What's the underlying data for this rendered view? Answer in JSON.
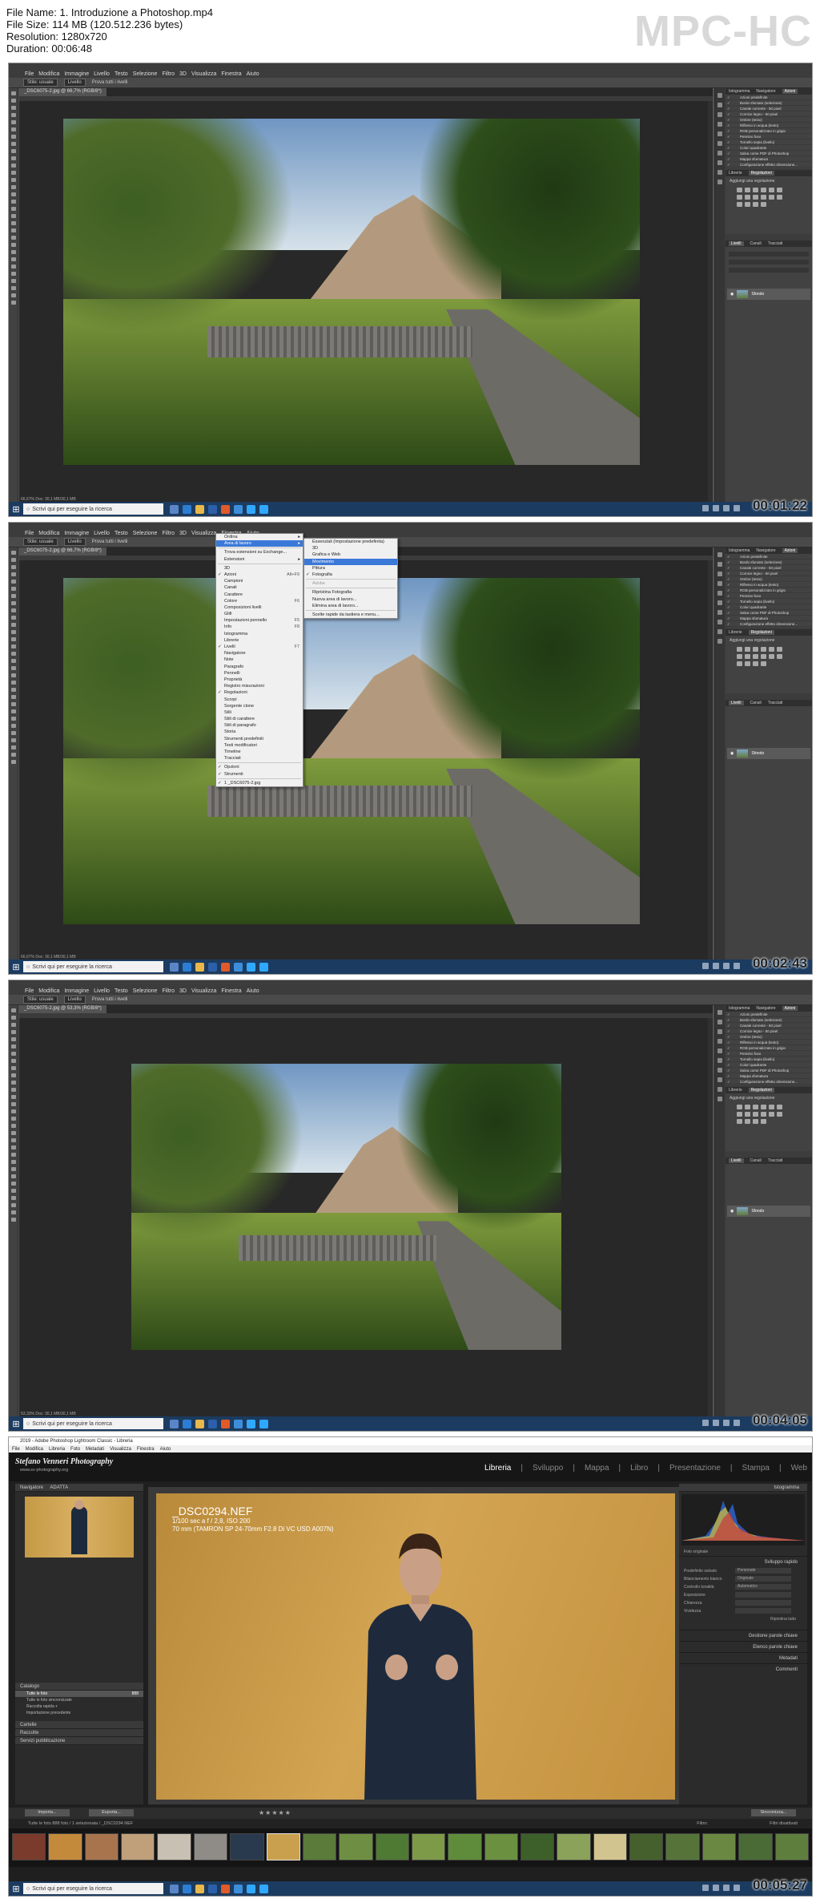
{
  "file_info": {
    "name": "File Name: 1. Introduzione a Photoshop.mp4",
    "size": "File Size: 114 MB (120.512.236 bytes)",
    "resolution": "Resolution: 1280x720",
    "duration": "Duration: 00:06:48"
  },
  "logo": "MPC-HC",
  "photoshop": {
    "menu": [
      "File",
      "Modifica",
      "Immagine",
      "Livello",
      "Testo",
      "Selezione",
      "Filtro",
      "3D",
      "Visualizza",
      "Finestra",
      "Aiuto"
    ],
    "options": {
      "style": "Stile: usuale",
      "level": "Livello",
      "sample": "Prova tutti i livelli"
    },
    "doc_tab_1": "_DSC6075-2.jpg @ 66,7% (RGB/8*)",
    "doc_tab_3": "_DSC6075-2.jpg @ 53,3% (RGB/8*)",
    "status_1": "66,67%   Doc: 30,1 MB/30,1 MB",
    "status_3": "53,33%   Doc: 30,1 MB/30,1 MB",
    "panel_tabs_top": [
      "Istogramma",
      "Navigatore",
      "Azioni"
    ],
    "actions": [
      "Azioni predefinite",
      "Bordo sfumato (selezione)",
      "Canale corrente - 50 pixel",
      "Cornice legno - 50 pixel",
      "Ombre (testo)",
      "Riflesso in acqua (testo)",
      "RGB personalizzato in grigio",
      "Pennino fuso",
      "Tornello sepia (livello)",
      "Colori quadrante",
      "Salva come PDF di Photoshop",
      "Mappa sfumatura",
      "Configurazione effetto dimensione..."
    ],
    "panel_tabs_mid": [
      "Librerie",
      "Regolazioni"
    ],
    "adj_label": "Aggiungi una regolazione",
    "panel_tabs_bottom": [
      "Livelli",
      "Canali",
      "Tracciati"
    ],
    "layer_name": "Sfondo",
    "search_placeholder": "Scrivi qui per eseguire la ricerca"
  },
  "window_menu": {
    "items": [
      {
        "label": "Ordina",
        "check": false,
        "shortcut": "",
        "arrow": true
      },
      {
        "label": "Area di lavoro",
        "check": false,
        "shortcut": "",
        "arrow": true,
        "selected": true
      },
      {
        "label": "",
        "sep": true
      },
      {
        "label": "Trova estensioni su Exchange...",
        "check": false,
        "shortcut": ""
      },
      {
        "label": "Estensioni",
        "check": false,
        "shortcut": "",
        "arrow": true
      },
      {
        "label": "",
        "sep": true
      },
      {
        "label": "3D",
        "check": false,
        "shortcut": ""
      },
      {
        "label": "Azioni",
        "check": true,
        "shortcut": "Alt+F9"
      },
      {
        "label": "Campioni",
        "check": false,
        "shortcut": ""
      },
      {
        "label": "Canali",
        "check": false,
        "shortcut": ""
      },
      {
        "label": "Carattere",
        "check": false,
        "shortcut": ""
      },
      {
        "label": "Colore",
        "check": false,
        "shortcut": "F6"
      },
      {
        "label": "Composizioni livelli",
        "check": false,
        "shortcut": ""
      },
      {
        "label": "Glifi",
        "check": false,
        "shortcut": ""
      },
      {
        "label": "Impostazioni pennello",
        "check": false,
        "shortcut": "F5"
      },
      {
        "label": "Info",
        "check": false,
        "shortcut": "F8"
      },
      {
        "label": "Istogramma",
        "check": false,
        "shortcut": ""
      },
      {
        "label": "Librerie",
        "check": false,
        "shortcut": ""
      },
      {
        "label": "Livelli",
        "check": true,
        "shortcut": "F7"
      },
      {
        "label": "Navigatore",
        "check": false,
        "shortcut": ""
      },
      {
        "label": "Note",
        "check": false,
        "shortcut": ""
      },
      {
        "label": "Paragrafo",
        "check": false,
        "shortcut": ""
      },
      {
        "label": "Pennelli",
        "check": false,
        "shortcut": ""
      },
      {
        "label": "Proprietà",
        "check": false,
        "shortcut": ""
      },
      {
        "label": "Registro misurazioni",
        "check": false,
        "shortcut": ""
      },
      {
        "label": "Regolazioni",
        "check": true,
        "shortcut": ""
      },
      {
        "label": "Scorpi",
        "check": false,
        "shortcut": ""
      },
      {
        "label": "Sorgente clone",
        "check": false,
        "shortcut": ""
      },
      {
        "label": "Stili",
        "check": false,
        "shortcut": ""
      },
      {
        "label": "Stili di carattere",
        "check": false,
        "shortcut": ""
      },
      {
        "label": "Stili di paragrafo",
        "check": false,
        "shortcut": ""
      },
      {
        "label": "Storia",
        "check": false,
        "shortcut": ""
      },
      {
        "label": "Strumenti predefiniti",
        "check": false,
        "shortcut": ""
      },
      {
        "label": "Testi modificatori",
        "check": false,
        "shortcut": ""
      },
      {
        "label": "Timeline",
        "check": false,
        "shortcut": ""
      },
      {
        "label": "Tracciati",
        "check": false,
        "shortcut": ""
      },
      {
        "label": "",
        "sep": true
      },
      {
        "label": "Opzioni",
        "check": true,
        "shortcut": ""
      },
      {
        "label": "Strumenti",
        "check": true,
        "shortcut": ""
      },
      {
        "label": "",
        "sep": true
      },
      {
        "label": "1 _DSC6075-2.jpg",
        "check": true,
        "shortcut": ""
      }
    ],
    "submenu": [
      {
        "label": "Essenziali (Impostazione predefinita)",
        "check": false
      },
      {
        "label": "3D",
        "check": false
      },
      {
        "label": "Grafica e Web",
        "check": false
      },
      {
        "label": "Movimento",
        "check": false,
        "selected": true
      },
      {
        "label": "Pittura",
        "check": false
      },
      {
        "label": "Fotografia",
        "check": true
      },
      {
        "label": "",
        "sep": true
      },
      {
        "label": "Adobe",
        "check": false,
        "dim": true
      },
      {
        "label": "",
        "sep": true
      },
      {
        "label": "Ripristina Fotografia",
        "check": false
      },
      {
        "label": "Nuova area di lavoro...",
        "check": false
      },
      {
        "label": "Elimina area di lavoro...",
        "check": false
      },
      {
        "label": "",
        "sep": true
      },
      {
        "label": "Scelte rapide da tastiera e menu...",
        "check": false
      }
    ]
  },
  "timestamps": [
    "00:01:22",
    "00:02:43",
    "00:04:05",
    "00:05:27"
  ],
  "lightroom": {
    "title": "2019 - Adobe Photoshop Lightroom Classic - Libreria",
    "menu": [
      "File",
      "Modifica",
      "Libreria",
      "Foto",
      "Metadati",
      "Visualizza",
      "Finestra",
      "Aiuto"
    ],
    "brand": "Stefano Venneri Photography",
    "brand_url": "www.sv-photography.org",
    "modules": [
      "Libreria",
      "Sviluppo",
      "Mappa",
      "Libro",
      "Presentazione",
      "Stampa",
      "Web"
    ],
    "navigator": "Navigatore",
    "navigator_mode": "ADATTA",
    "catalog": "Catalogo",
    "catalog_items": [
      {
        "label": "Tutte le foto",
        "count": "888"
      },
      {
        "label": "Tutte le foto sincronizzate",
        "count": ""
      },
      {
        "label": "Raccolta rapida +",
        "count": ""
      },
      {
        "label": "Importazione precedente",
        "count": ""
      }
    ],
    "left_sections": [
      "Cartelle",
      "Raccolte",
      "Servizi pubblicazione"
    ],
    "overlay_file": "_DSC0294.NEF",
    "overlay_exposure": "1/100 sec a f / 2,8, ISO 200",
    "overlay_lens": "70 mm (TAMRON SP 24-70mm F2.8 Di VC USD A007N)",
    "histogram": "Istogramma",
    "histogram_info": "Foto originale",
    "quick_develop": "Sviluppo rapido",
    "qd_rows": [
      {
        "label": "Predefinito salvato",
        "value": "Personale"
      },
      {
        "label": "Bilanciamento bianco",
        "value": "Originale"
      },
      {
        "label": "Controllo tonalità",
        "value": "Automatico"
      },
      {
        "label": "Esposizione",
        "value": ""
      },
      {
        "label": "Chiarezza",
        "value": ""
      },
      {
        "label": "Vividezza",
        "value": ""
      }
    ],
    "reset": "Ripristina tutto",
    "right_sections": [
      "Gestione parole chiave",
      "Elenco parole chiave",
      "Metadati",
      "Commenti"
    ],
    "import_btn": "Importa...",
    "export_btn": "Esporta...",
    "sync_btn": "Sincronizza...",
    "filmstrip_path": "Tutte le foto   888 foto / 1 selezionata / _DSC0294.NEF",
    "filter_label": "Filtro:",
    "filter_value": "Filtri disattivati"
  }
}
